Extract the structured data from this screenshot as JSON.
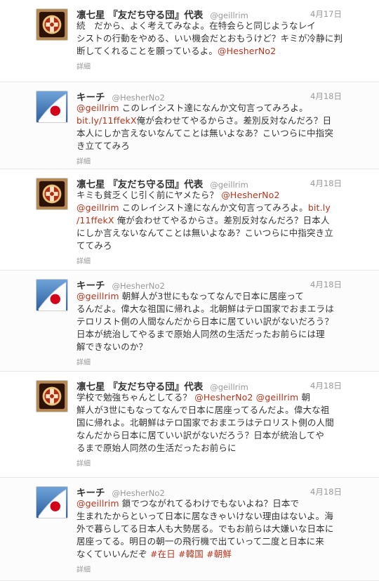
{
  "tweets": [
    {
      "avatar": "kanji-badge-avatar",
      "name": "凛七星 『友だち守る団』代表",
      "handle": "@geillrim",
      "date": "4月17日",
      "lines": [
        [
          {
            "t": "続　だから、よく考えてみなよ。在特会らと同じようなレイ"
          }
        ],
        [
          {
            "t": "シストの行動をやめる、いい機会だとおもうけど？キミが冷静に判"
          }
        ],
        [
          {
            "t": "断してくれることを願っているよ。"
          },
          {
            "t": "@HesherNo2",
            "link": true
          }
        ]
      ],
      "details": "詳細"
    },
    {
      "avatar": "japan-flag-avatar",
      "name": "キーチ",
      "handle": "@HesherNo2",
      "date": "4月18日",
      "lines": [
        [
          {
            "t": "@geillrim",
            "link": true
          },
          {
            "t": " このレイシスト達になんか文句言ってみろよ。"
          }
        ],
        [
          {
            "t": "bit.ly/11ffekX",
            "link": true
          },
          {
            "t": "俺が会わせてやるからさ。差別反対なんだろ？日"
          }
        ],
        [
          {
            "t": "本人にしか言えないなんてことは無いよなあ？こいつらに中指突"
          }
        ],
        [
          {
            "t": "き立ててみろ"
          }
        ]
      ],
      "details": "詳細"
    },
    {
      "avatar": "kanji-badge-avatar",
      "name": "凛七星 『友だち守る団』代表",
      "handle": "@geillrim",
      "date": "4月18日",
      "lines": [
        [
          {
            "t": "キミも貧乏くじ引く前にヤメたら？ "
          },
          {
            "t": "@HesherNo2",
            "link": true
          }
        ],
        [
          {
            "t": "@geillrim",
            "link": true
          },
          {
            "t": " このレイシスト達になんか文句言ってみろよ。"
          },
          {
            "t": "bit.ly",
            "link": true
          }
        ],
        [
          {
            "t": "/11ffekX",
            "link": true
          },
          {
            "t": " 俺が会わせてやるからさ。差別反対なんだろ？日本人"
          }
        ],
        [
          {
            "t": "にしか言えないなんてことは無いよなあ？こいつらに中指突き立"
          }
        ],
        [
          {
            "t": "ててみろ"
          }
        ]
      ],
      "details": "詳細"
    },
    {
      "avatar": "japan-flag-avatar",
      "name": "キーチ",
      "handle": "@HesherNo2",
      "date": "4月18日",
      "lines": [
        [
          {
            "t": "@geillrim",
            "link": true
          },
          {
            "t": " 朝鮮人が3世にもなってなんで日本に居座って"
          }
        ],
        [
          {
            "t": "るんだよ。偉大な祖国に帰れよ。北朝鮮はテロ国家でおまエラは"
          }
        ],
        [
          {
            "t": "テロリスト側の人間なんだから日本に居ていい訳がないだろう？"
          }
        ],
        [
          {
            "t": "日本が統治してやるまで原始人同然の生活だったお前らには理"
          }
        ],
        [
          {
            "t": "解できないのか？"
          }
        ]
      ],
      "details": "詳細"
    },
    {
      "avatar": "kanji-badge-avatar",
      "name": "凛七星 『友だち守る団』代表",
      "handle": "@geillrim",
      "date": "4月18日",
      "lines": [
        [
          {
            "t": "学校で勉強ちゃんとしてる？ "
          },
          {
            "t": "@HesherNo2",
            "link": true
          },
          {
            "t": " "
          },
          {
            "t": "@geillrim",
            "link": true
          },
          {
            "t": " 朝"
          }
        ],
        [
          {
            "t": "鮮人が3世にもなってなんで日本に居座ってるんだよ。偉大な祖"
          }
        ],
        [
          {
            "t": "国に帰れよ。北朝鮮はテロ国家でおまエラはテロリスト側の人間"
          }
        ],
        [
          {
            "t": "なんだから日本に居ていい訳がないだろう？日本が統治してや"
          }
        ],
        [
          {
            "t": "るまで原始人同然の生活だったお前らに"
          }
        ]
      ],
      "details": "詳細"
    },
    {
      "avatar": "japan-flag-avatar",
      "name": "キーチ",
      "handle": "@HesherNo2",
      "date": "4月18日",
      "lines": [
        [
          {
            "t": "@geillrim",
            "link": true
          },
          {
            "t": " 鎖でつながれてるわけでもないよね？日本で"
          }
        ],
        [
          {
            "t": "生まれたからといって日本に居なきゃいけない理由はないよ。海"
          }
        ],
        [
          {
            "t": "外で暮らしてる日本人も大勢居る。でもお前らは大嫌いな日本に"
          }
        ],
        [
          {
            "t": "居座ってる。明日の朝一の飛行機で出ていって二度と日本に来"
          }
        ],
        [
          {
            "t": "なくていいんだぞ "
          },
          {
            "t": "#在日",
            "link": true
          },
          {
            "t": " "
          },
          {
            "t": "#韓国",
            "link": true
          },
          {
            "t": " "
          },
          {
            "t": "#朝鮮",
            "link": true
          }
        ]
      ],
      "details": "詳細"
    }
  ],
  "colors": {
    "link": "#b8341b",
    "name": "#333333",
    "meta": "#999999",
    "flag_red": "#d20019",
    "badge_bg": "#2d1208",
    "badge_red": "#b52818",
    "badge_gold": "#e9c27a"
  }
}
